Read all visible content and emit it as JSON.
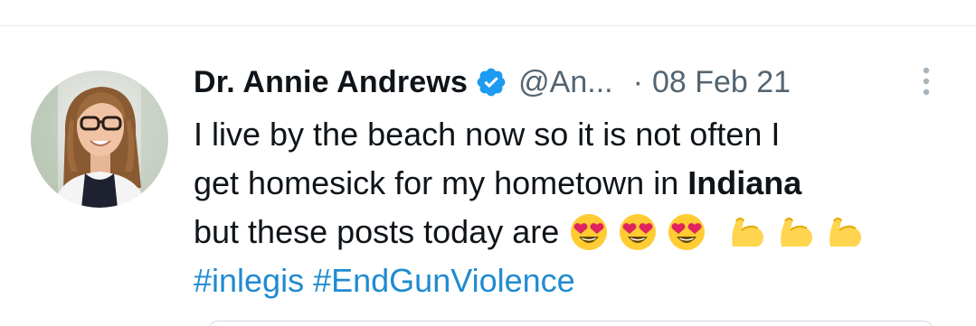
{
  "tweet": {
    "author": {
      "display_name": "Dr. Annie Andrews",
      "handle": "@An...",
      "verified": true,
      "avatar_icon": "avatar"
    },
    "separator": "·",
    "timestamp": "08 Feb 21",
    "body": {
      "line1": "I live by the beach now so it is not often I",
      "line2_prefix": "get homesick for my hometown in ",
      "line2_bold": "Indiana",
      "line3_prefix": "but these posts today are ",
      "emojis": [
        "heart-eyes-emoji",
        "heart-eyes-emoji",
        "heart-eyes-emoji",
        "flexed-biceps-emoji",
        "flexed-biceps-emoji",
        "flexed-biceps-emoji"
      ],
      "hashtags": [
        "#inlegis",
        "#EndGunViolence"
      ]
    },
    "colors": {
      "link": "#1f8bd0",
      "verified_badge": "#1d9bf0",
      "secondary_text": "#536471",
      "primary_text": "#0f1419"
    }
  }
}
